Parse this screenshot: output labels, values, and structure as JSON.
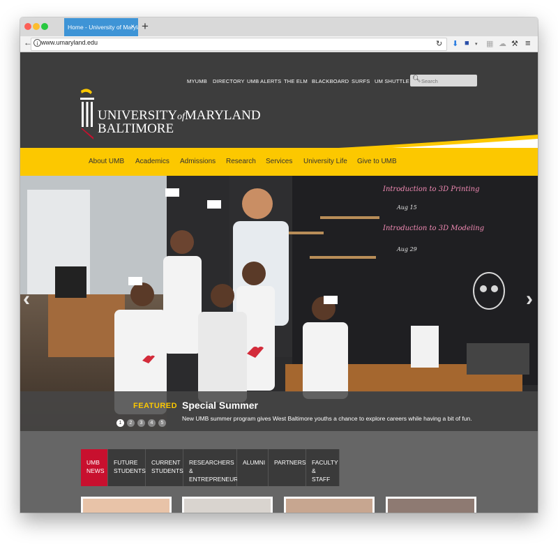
{
  "browser": {
    "tab_title": "Home - University of Maryland, B",
    "tab_close": "×",
    "new_tab": "+",
    "url": "www.umaryland.edu"
  },
  "header": {
    "top_links": [
      "MYUMB",
      "DIRECTORY",
      "UMB ALERTS",
      "THE ELM",
      "BLACKBOARD",
      "SURFS",
      "UM SHUTTLE"
    ],
    "search_placeholder": "Search",
    "logo_line1_a": "UNIVERSITY",
    "logo_line1_of": "of",
    "logo_line1_b": "MARYLAND",
    "logo_line2": "BALTIMORE"
  },
  "main_nav": [
    "About UMB",
    "Academics",
    "Admissions",
    "Research",
    "Services",
    "University Life",
    "Give to UMB"
  ],
  "hero": {
    "featured_label": "FEATURED",
    "title": "Special Summer",
    "description": "New UMB summer program gives West Baltimore youths a chance to explore careers while having a bit of fun.",
    "slides": [
      "1",
      "2",
      "3",
      "4",
      "5"
    ],
    "active_slide": 1,
    "chalkboard_1": "Introduction to 3D Printing",
    "chalkboard_1_date": "Aug 15",
    "chalkboard_2": "Introduction to 3D Modeling",
    "chalkboard_2_date": "Aug 29"
  },
  "news_tabs": [
    {
      "line1": "UMB",
      "line2": "NEWS"
    },
    {
      "line1": "FUTURE",
      "line2": "STUDENTS"
    },
    {
      "line1": "CURRENT",
      "line2": "STUDENTS"
    },
    {
      "line1": "RESEARCHERS &",
      "line2": "ENTREPRENEURS"
    },
    {
      "line1": "ALUMNI",
      "line2": ""
    },
    {
      "line1": "PARTNERS",
      "line2": ""
    },
    {
      "line1": "FACULTY",
      "line2": "& STAFF"
    }
  ],
  "colors": {
    "brand_gold": "#fcc800",
    "brand_red": "#c8102e",
    "header_dark": "#3d3d3d"
  }
}
